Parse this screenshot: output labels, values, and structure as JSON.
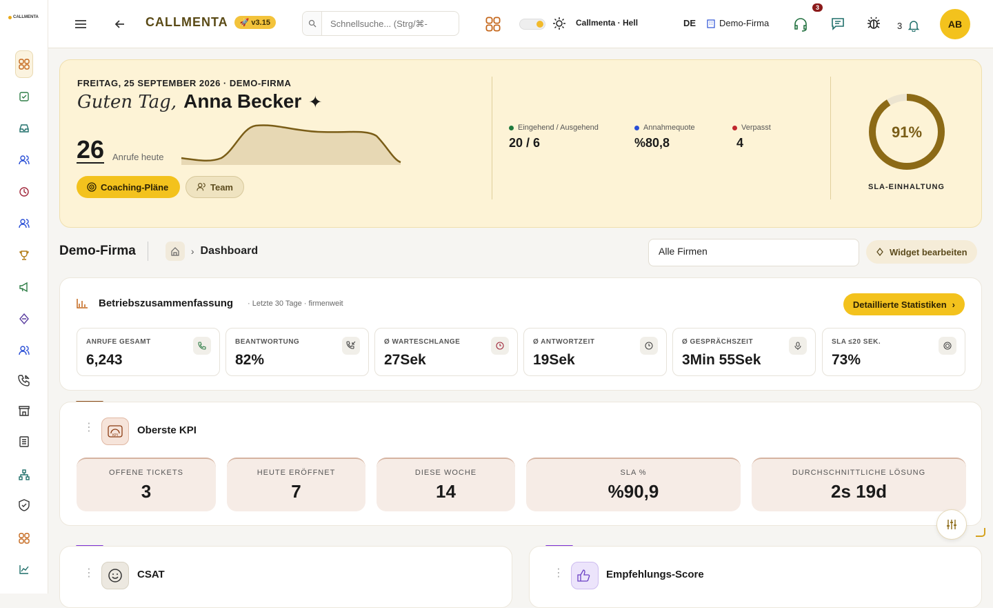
{
  "app": {
    "logo_text": "CALLMENTA",
    "brand": "CALLMENTA",
    "version": "v3.15"
  },
  "search": {
    "placeholder": "Schnellsuche... (Strg/⌘-"
  },
  "theme": {
    "label": "Callmenta · Hell"
  },
  "header": {
    "lang": "DE",
    "company": "Demo-Firma",
    "support_badge": "3",
    "notif_count": "3",
    "avatar": "AB"
  },
  "sidebar": {
    "icons": [
      "dashboard-icon",
      "tasks-icon",
      "inbox-icon",
      "users-icon",
      "clock-icon",
      "team-icon",
      "trophy-icon",
      "megaphone-icon",
      "diamond-icon",
      "contacts-icon",
      "calls-icon",
      "store-icon",
      "reports-icon",
      "org-icon",
      "shield-icon",
      "grid-icon",
      "chart-icon"
    ]
  },
  "hero": {
    "date": "FREITAG, 25 SEPTEMBER 2026 · DEMO-FIRMA",
    "greeting": "Guten Tag,",
    "name": "Anna Becker",
    "calls_today": "26",
    "calls_label": "Anrufe heute",
    "coaching_btn": "Coaching-Pläne",
    "team_btn": "Team",
    "stats": [
      {
        "label": "Eingehend / Ausgehend",
        "value": "20 / 6",
        "color": "#1f7a3d"
      },
      {
        "label": "Annahmequote",
        "value": "%80,8",
        "color": "#2a4fd6"
      },
      {
        "label": "Verpasst",
        "value": "4",
        "color": "#c0272d"
      }
    ],
    "sla_value": "91%",
    "sla_fraction": 0.91,
    "sla_label": "SLA-EINHALTUNG"
  },
  "breadcrumb": {
    "company": "Demo-Firma",
    "page": "Dashboard"
  },
  "filter": {
    "value": "Alle Firmen"
  },
  "widget_btn": "Widget bearbeiten",
  "summary": {
    "title": "Betriebszusammenfassung",
    "subtitle": "· Letzte 30 Tage · firmenweit",
    "detail_btn": "Detaillierte Statistiken",
    "metrics": [
      {
        "label": "ANRUFE GESAMT",
        "value": "6,243",
        "icon": "phone-icon"
      },
      {
        "label": "BEANTWORTUNG",
        "value": "82%",
        "icon": "incoming-call-icon"
      },
      {
        "label": "Ø WARTESCHLANGE",
        "value": "27Sek",
        "icon": "timer-icon"
      },
      {
        "label": "Ø ANTWORTZEIT",
        "value": "19Sek",
        "icon": "clock-icon"
      },
      {
        "label": "Ø GESPRÄCHSZEIT",
        "value": "3Min 55Sek",
        "icon": "mic-icon"
      },
      {
        "label": "SLA ≤20 SEK.",
        "value": "73%",
        "icon": "target-icon"
      }
    ]
  },
  "kpi": {
    "title": "Oberste KPI",
    "items": [
      {
        "label": "OFFENE TICKETS",
        "value": "3"
      },
      {
        "label": "HEUTE ERÖFFNET",
        "value": "7"
      },
      {
        "label": "DIESE WOCHE",
        "value": "14"
      },
      {
        "label": "SLA %",
        "value": "%90,9"
      },
      {
        "label": "DURCHSCHNITTLICHE LÖSUNG",
        "value": "2s 19d"
      }
    ]
  },
  "csat": {
    "title": "CSAT"
  },
  "nps": {
    "title": "Empfehlungs-Score"
  }
}
